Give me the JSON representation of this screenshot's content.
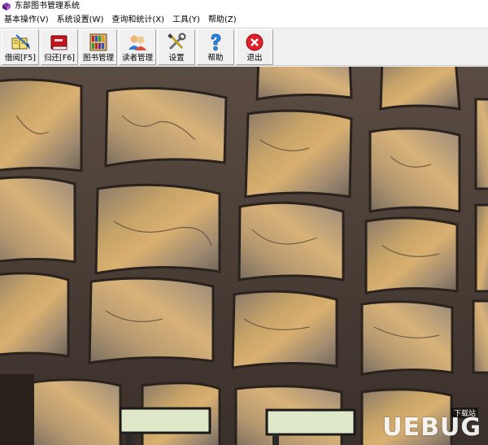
{
  "window": {
    "title": "东部图书管理系统"
  },
  "menu": [
    {
      "label": "基本操作(V)"
    },
    {
      "label": "系统设置(W)"
    },
    {
      "label": "查询和统计(X)"
    },
    {
      "label": "工具(Y)"
    },
    {
      "label": "帮助(Z)"
    }
  ],
  "toolbar": [
    {
      "label": "借阅[F5]",
      "icon": "borrow-book-icon"
    },
    {
      "label": "归还[F6]",
      "icon": "return-book-icon"
    },
    {
      "label": "图书管理",
      "icon": "book-management-icon"
    },
    {
      "label": "读者管理",
      "icon": "reader-management-icon"
    },
    {
      "label": "设置",
      "icon": "settings-tools-icon"
    },
    {
      "label": "帮助",
      "icon": "help-icon"
    },
    {
      "label": "退出",
      "icon": "exit-icon"
    }
  ],
  "watermark": {
    "text": "UEBUG",
    "sub": "下载站"
  },
  "colors": {
    "titlebar": "#ffffff",
    "toolbar": "#f0f0f0",
    "exit_red": "#e0202a",
    "help_blue": "#2a8ae8"
  }
}
